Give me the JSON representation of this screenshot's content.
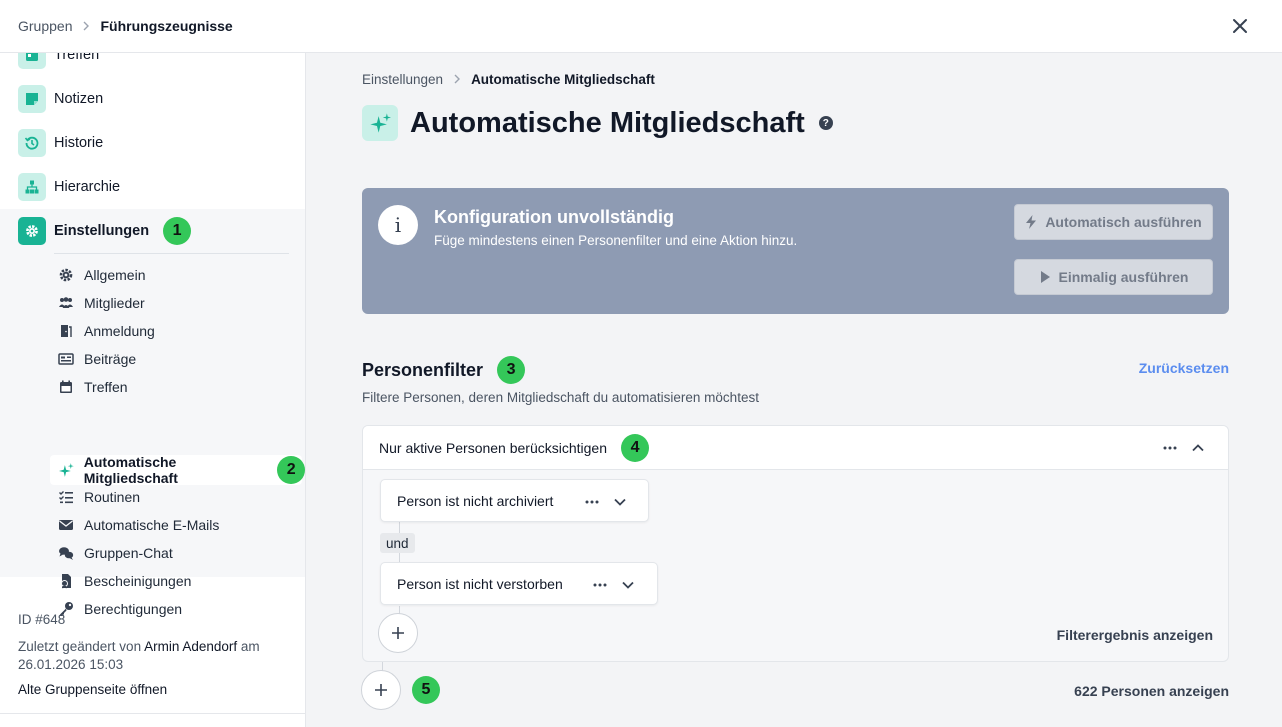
{
  "topbar": {
    "breadcrumb_parent": "Gruppen",
    "breadcrumb_current": "Führungszeugnisse"
  },
  "sidebar": {
    "items": [
      {
        "label": "Treffen",
        "icon": "calendar-icon"
      },
      {
        "label": "Notizen",
        "icon": "note-icon"
      },
      {
        "label": "Historie",
        "icon": "history-icon"
      },
      {
        "label": "Hierarchie",
        "icon": "hierarchy-icon"
      }
    ],
    "settings": {
      "label": "Einstellungen",
      "badge": "1",
      "subitems": [
        {
          "label": "Allgemein",
          "icon": "gear-icon"
        },
        {
          "label": "Mitglieder",
          "icon": "members-icon"
        },
        {
          "label": "Anmeldung",
          "icon": "door-icon"
        },
        {
          "label": "Beiträge",
          "icon": "money-icon"
        },
        {
          "label": "Treffen",
          "icon": "calendar-icon"
        },
        {
          "label": "Automatische Mitgliedschaft",
          "icon": "sparkle-icon"
        },
        {
          "label": "Routinen",
          "icon": "checklist-icon"
        },
        {
          "label": "Automatische E-Mails",
          "icon": "mail-icon"
        },
        {
          "label": "Gruppen-Chat",
          "icon": "chat-icon"
        },
        {
          "label": "Bescheinigungen",
          "icon": "certificate-icon"
        },
        {
          "label": "Berechtigungen",
          "icon": "key-icon"
        }
      ],
      "active_badge": "2"
    },
    "meta": {
      "id": "ID #648",
      "changed_prefix": "Zuletzt geändert von",
      "changed_by": "Armin Adendorf",
      "changed_suffix": "am",
      "changed_at": "26.01.2026 15:03",
      "old_page_link": "Alte Gruppenseite öffnen"
    }
  },
  "main": {
    "breadcrumb_parent": "Einstellungen",
    "breadcrumb_current": "Automatische Mitgliedschaft",
    "title": "Automatische Mitgliedschaft",
    "help": "?",
    "banner": {
      "info": "i",
      "title": "Konfiguration unvollständig",
      "subtitle": "Füge mindestens einen Personenfilter und eine Aktion hinzu.",
      "btn_auto": "Automatisch ausführen",
      "btn_once": "Einmalig ausführen"
    },
    "filter_section": {
      "title": "Personenfilter",
      "badge": "3",
      "reset": "Zurücksetzen",
      "description": "Filtere Personen, deren Mitgliedschaft du automatisieren möchtest",
      "group": {
        "title": "Nur aktive Personen berücksichtigen",
        "badge": "4",
        "filters": [
          "Person ist nicht archiviert",
          "Person ist nicht verstorben"
        ],
        "connector": "und",
        "show_result": "Filterergebnis anzeigen"
      },
      "add_badge": "5",
      "show_persons": "622 Personen anzeigen"
    }
  },
  "colors": {
    "accent": "#19b394",
    "badge": "#34c759",
    "banner": "#8e9bb3",
    "link": "#5b8def"
  }
}
